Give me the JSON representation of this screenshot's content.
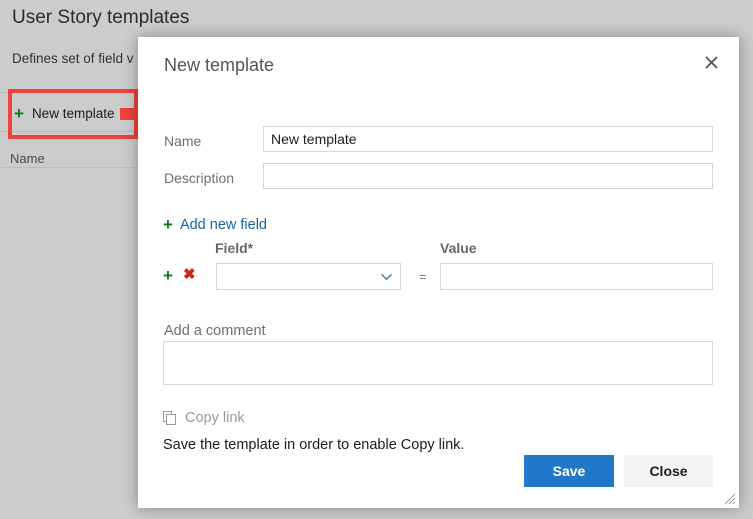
{
  "background": {
    "title": "User Story templates",
    "subtitle": "Defines set of field v",
    "new_template_button": "New template",
    "new_template_icon": "plus-icon",
    "list_column_header": "Name"
  },
  "annotation": {
    "color": "#f2403a",
    "highlight_target": "new-template-button",
    "arrow": "right-arrow"
  },
  "dialog": {
    "title": "New template",
    "close_icon": "close-icon",
    "fields": {
      "name_label": "Name",
      "name_value": "New template",
      "name_placeholder": "",
      "description_label": "Description",
      "description_value": "",
      "description_placeholder": ""
    },
    "add_new_field": {
      "label": "Add new field",
      "icon": "plus-icon"
    },
    "field_table": {
      "field_header": "Field*",
      "value_header": "Value",
      "operator": "=",
      "rows": [
        {
          "add_icon": "plus-icon",
          "delete_icon": "close-x-icon",
          "field_selected": "",
          "field_placeholder": "",
          "value": "",
          "value_placeholder": "",
          "chevron_icon": "chevron-down-icon"
        }
      ]
    },
    "comment": {
      "label": "Add a comment",
      "value": "",
      "placeholder": ""
    },
    "copy_link": {
      "label": "Copy link",
      "icon": "copy-icon",
      "hint": "Save the template in order to enable Copy link."
    },
    "footer": {
      "save_label": "Save",
      "close_label": "Close",
      "save_color": "#2078ca"
    },
    "resize_grip_icon": "resize-grip-icon"
  }
}
